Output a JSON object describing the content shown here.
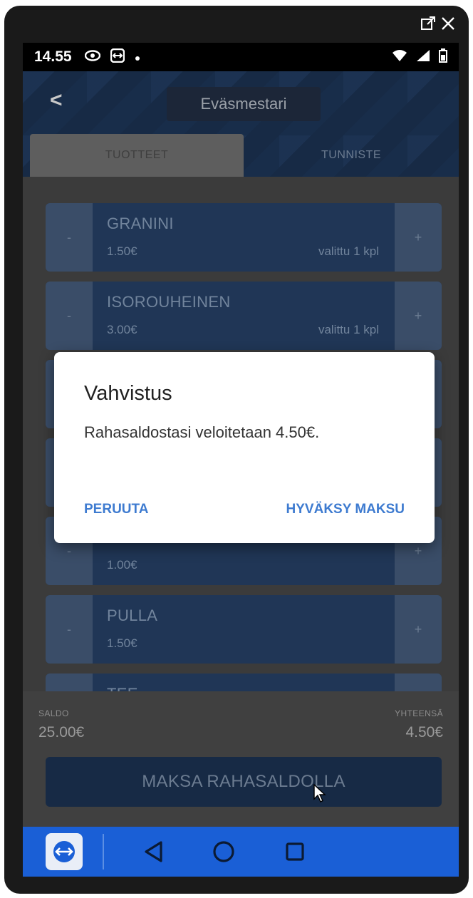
{
  "window": {
    "popout_icon": "popout-icon",
    "close_icon": "close-icon"
  },
  "statusbar": {
    "time": "14.55",
    "icons": [
      "eye-icon",
      "teamviewer-icon",
      "dot-icon"
    ],
    "right_icons": [
      "wifi-icon",
      "signal-icon",
      "battery-icon"
    ]
  },
  "header": {
    "back_label": "<",
    "title": "Eväsmestari"
  },
  "tabs": [
    {
      "label": "TUOTTEET",
      "active": true
    },
    {
      "label": "TUNNISTE",
      "active": false
    }
  ],
  "products": [
    {
      "name": "GRANINI",
      "price": "1.50€",
      "selected": "valittu 1 kpl"
    },
    {
      "name": "ISOROUHEINEN",
      "price": "3.00€",
      "selected": "valittu 1 kpl"
    },
    {
      "name": "",
      "price": "",
      "selected": ""
    },
    {
      "name": "",
      "price": "",
      "selected": ""
    },
    {
      "name": "",
      "price": "1.00€",
      "selected": ""
    },
    {
      "name": "PULLA",
      "price": "1.50€",
      "selected": ""
    },
    {
      "name": "TEE",
      "price": "",
      "selected": ""
    }
  ],
  "stepper": {
    "minus": "-",
    "plus": "+"
  },
  "footer": {
    "saldo_label": "SALDO",
    "saldo_value": "25.00€",
    "total_label": "YHTEENSÄ",
    "total_value": "4.50€",
    "pay_button": "MAKSA RAHASALDOLLA"
  },
  "dialog": {
    "title": "Vahvistus",
    "message": "Rahasaldostasi veloitetaan 4.50€.",
    "cancel": "PERUUTA",
    "confirm": "HYVÄKSY MAKSU"
  },
  "navbar": {
    "icons": [
      "teamviewer-icon",
      "back-triangle-icon",
      "home-circle-icon",
      "recents-square-icon"
    ]
  },
  "colors": {
    "accent": "#3e7bd0",
    "navbar": "#1a5fd6",
    "product_bg": "#203656"
  }
}
